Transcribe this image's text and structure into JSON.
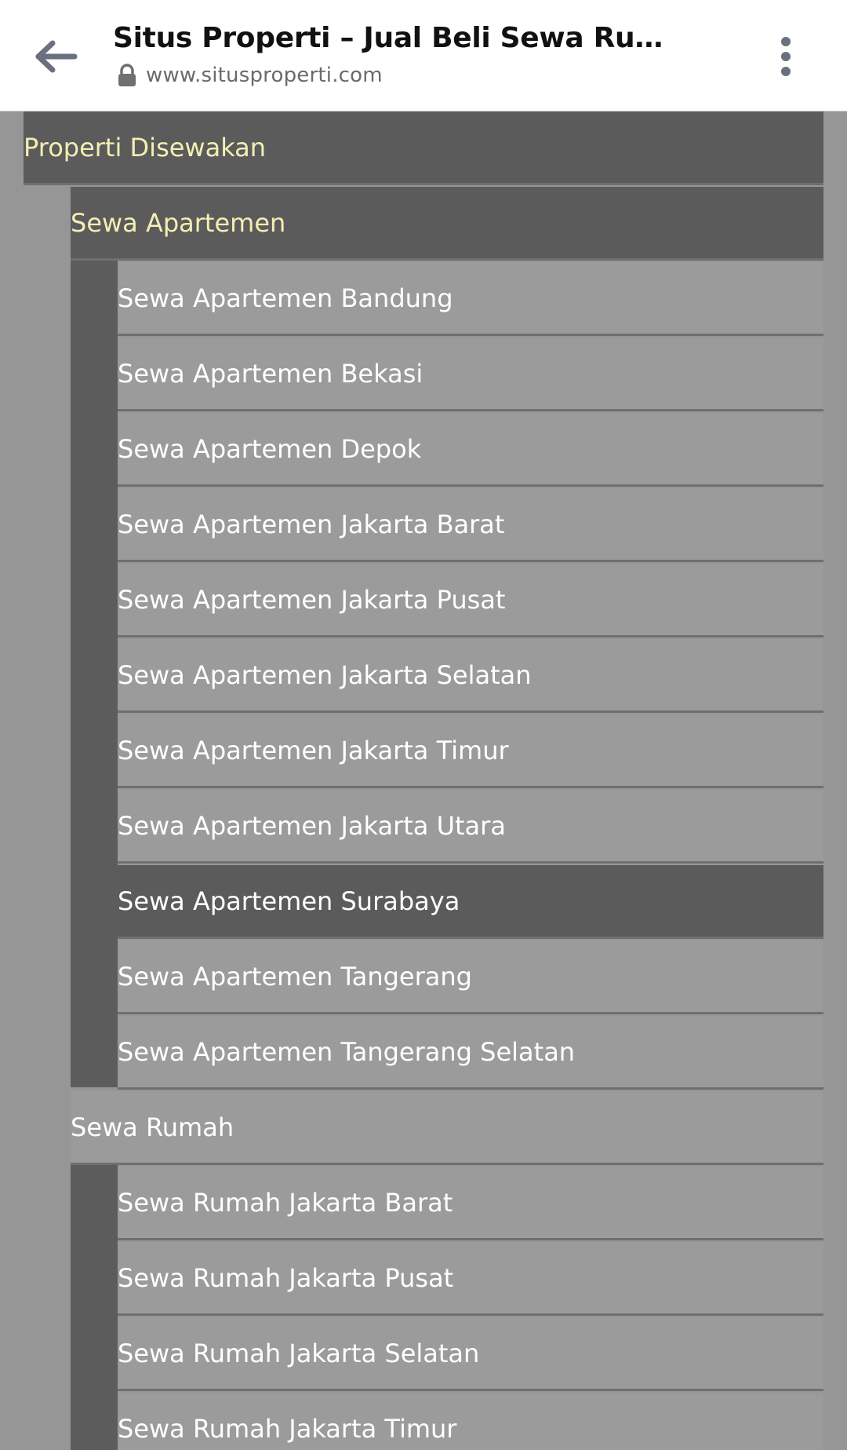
{
  "browser": {
    "title": "Situs Properti – Jual Beli Sewa Rumah,...",
    "url": "www.situsproperti.com",
    "icons": {
      "back": "arrow-left-icon",
      "lock": "lock-icon",
      "menu": "more-vertical-icon"
    }
  },
  "colors": {
    "page_bg": "#969696",
    "dark_bg": "#5b5b5b",
    "light_bg": "#9b9b9b",
    "highlight_text": "#f2efb4",
    "text": "#ffffff"
  },
  "nav": {
    "root": "Properti Disewakan",
    "apartemen": {
      "label": "Sewa Apartemen",
      "items": [
        "Sewa Apartemen Bandung",
        "Sewa Apartemen Bekasi",
        "Sewa Apartemen Depok",
        "Sewa Apartemen Jakarta Barat",
        "Sewa Apartemen Jakarta Pusat",
        "Sewa Apartemen Jakarta Selatan",
        "Sewa Apartemen Jakarta Timur",
        "Sewa Apartemen Jakarta Utara",
        "Sewa Apartemen Surabaya",
        "Sewa Apartemen Tangerang",
        "Sewa Apartemen Tangerang Selatan"
      ]
    },
    "rumah": {
      "label": "Sewa Rumah",
      "items": [
        "Sewa Rumah Jakarta Barat",
        "Sewa Rumah Jakarta Pusat",
        "Sewa Rumah Jakarta Selatan",
        "Sewa Rumah Jakarta Timur"
      ]
    }
  }
}
